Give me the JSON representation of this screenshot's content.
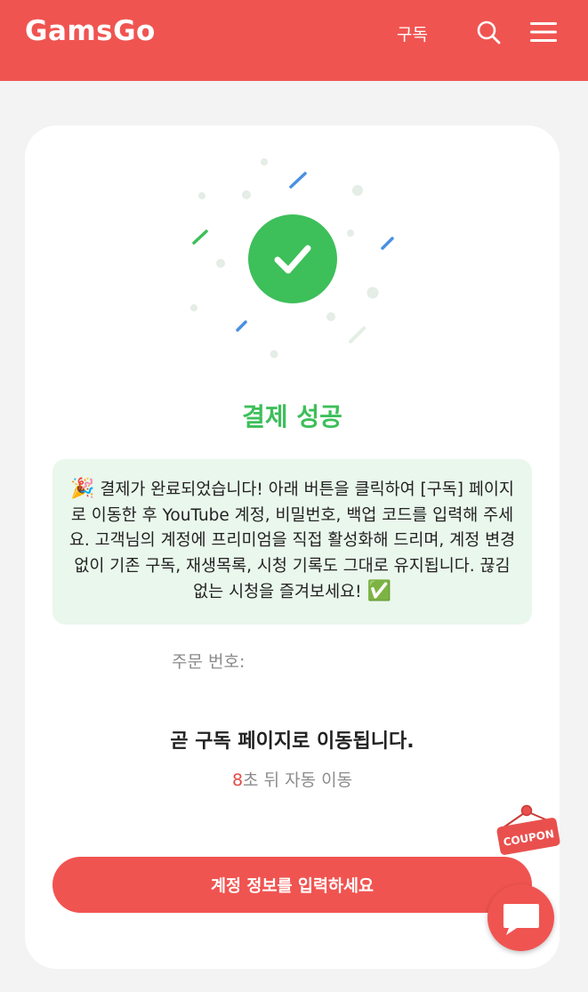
{
  "header": {
    "logo": "GamsGo",
    "subscription_label": "구독",
    "icons": [
      "search-icon",
      "menu-icon"
    ],
    "color": "#f05451"
  },
  "success": {
    "icon": "check-icon",
    "title": "결제 성공",
    "notice_emoji_start": "🎉",
    "notice_text": "결제가 완료되었습니다! 아래 버튼을 클릭하여 [구독] 페이지로 이동한 후 YouTube 계정, 비밀번호, 백업 코드를 입력해 주세요. 고객님의 계정에 프리미엄을 직접 활성화해 드리며, 계정 변경 없이 기존 구독, 재생목록, 시청 기록도 그대로 유지됩니다. 끊김 없는 시청을 즐겨보세요!",
    "notice_emoji_end": "✅",
    "order_label": "주문 번호:",
    "order_value": "",
    "redirect_message": "곧 구독 페이지로 이동됩니다.",
    "countdown_value": "8",
    "countdown_text": "초 뒤 자동 이동",
    "cta_label": "계정 정보를 입력하세요",
    "accent_color": "#3dbf5a"
  },
  "floating": {
    "coupon_label": "COUPON",
    "chat_icon": "chat-icon"
  }
}
